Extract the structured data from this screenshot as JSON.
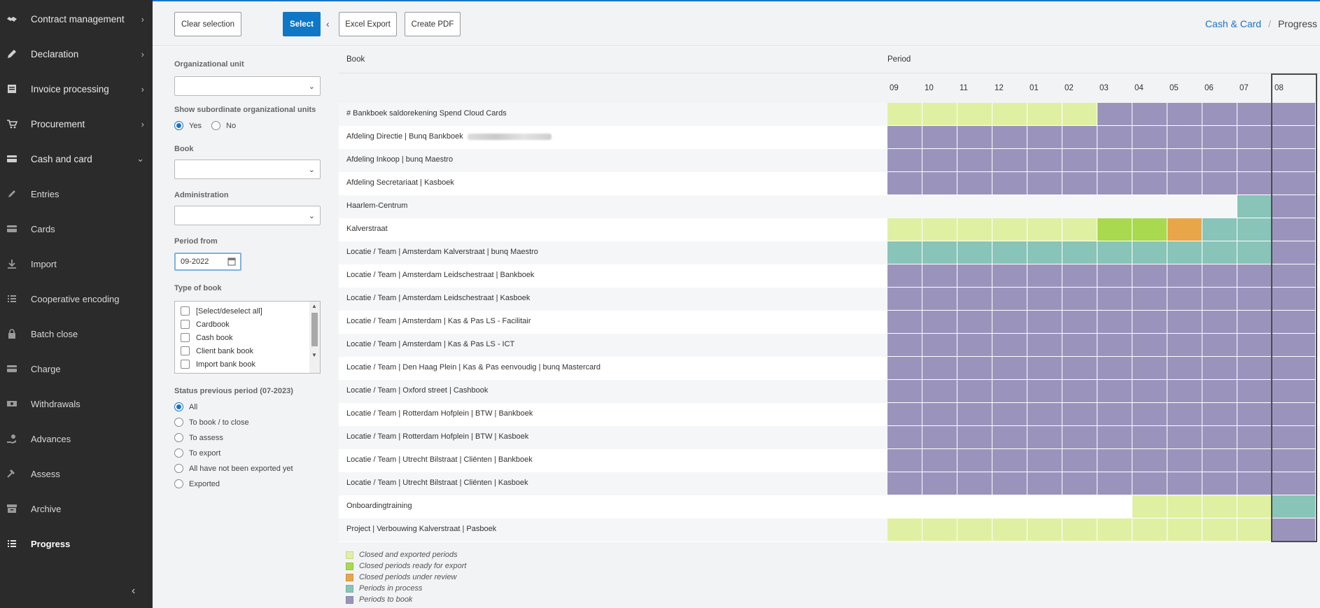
{
  "sidebar": {
    "items": [
      {
        "label": "Contract management",
        "icon": "handshake-icon",
        "chevron": "›"
      },
      {
        "label": "Declaration",
        "icon": "pencil-icon",
        "chevron": "›"
      },
      {
        "label": "Invoice processing",
        "icon": "document-icon",
        "chevron": "›"
      },
      {
        "label": "Procurement",
        "icon": "cart-icon",
        "chevron": "›"
      },
      {
        "label": "Cash and card",
        "icon": "card-icon",
        "chevron": "⌄"
      },
      {
        "label": "Entries",
        "icon": "pen-icon"
      },
      {
        "label": "Cards",
        "icon": "card-icon"
      },
      {
        "label": "Import",
        "icon": "download-icon"
      },
      {
        "label": "Cooperative encoding",
        "icon": "list-icon"
      },
      {
        "label": "Batch close",
        "icon": "lock-icon"
      },
      {
        "label": "Charge",
        "icon": "card-icon"
      },
      {
        "label": "Withdrawals",
        "icon": "cash-icon"
      },
      {
        "label": "Advances",
        "icon": "hand-coins-icon"
      },
      {
        "label": "Assess",
        "icon": "gavel-icon"
      },
      {
        "label": "Archive",
        "icon": "archive-icon"
      },
      {
        "label": "Progress",
        "icon": "list-icon"
      }
    ],
    "collapse": "‹"
  },
  "toolbar": {
    "clear_label": "Clear selection",
    "select_label": "Select",
    "chevron": "‹",
    "excel_label": "Excel Export",
    "pdf_label": "Create PDF"
  },
  "breadcrumb": {
    "parent": "Cash & Card",
    "separator": "/",
    "current": "Progress"
  },
  "filters": {
    "org_unit_label": "Organizational unit",
    "subordinate_label": "Show subordinate organizational units",
    "yes_label": "Yes",
    "no_label": "No",
    "subordinate_value": "Yes",
    "book_label": "Book",
    "administration_label": "Administration",
    "period_from_label": "Period from",
    "period_from_value": "09-2022",
    "type_label": "Type of book",
    "types": [
      "[Select/deselect all]",
      "Cardbook",
      "Cash book",
      "Client bank book",
      "Import bank book"
    ],
    "status_label": "Status previous period (07-2023)",
    "status_options": [
      "All",
      "To book / to close",
      "To assess",
      "To export",
      "All have not been exported yet",
      "Exported"
    ],
    "status_selected": "All"
  },
  "grid": {
    "book_header": "Book",
    "period_header": "Period",
    "months": [
      "09",
      "10",
      "11",
      "12",
      "01",
      "02",
      "03",
      "04",
      "05",
      "06",
      "07",
      "08"
    ],
    "current_month": "08",
    "status_colors": {
      "X": "#e0f0a2",
      "R": "#a9d94e",
      "U": "#e9a649",
      "P": "#88c4b8",
      "B": "#9a94bd",
      "N": ""
    },
    "rows": [
      {
        "book": "# Bankboek saldorekening Spend Cloud Cards",
        "statuses": [
          "X",
          "X",
          "X",
          "X",
          "X",
          "X",
          "B",
          "B",
          "B",
          "B",
          "B",
          "B"
        ]
      },
      {
        "book": "Afdeling Directie | Bunq Bankboek",
        "redacted": true,
        "statuses": [
          "B",
          "B",
          "B",
          "B",
          "B",
          "B",
          "B",
          "B",
          "B",
          "B",
          "B",
          "B"
        ]
      },
      {
        "book": "Afdeling Inkoop | bunq Maestro",
        "statuses": [
          "B",
          "B",
          "B",
          "B",
          "B",
          "B",
          "B",
          "B",
          "B",
          "B",
          "B",
          "B"
        ]
      },
      {
        "book": "Afdeling Secretariaat | Kasboek",
        "statuses": [
          "B",
          "B",
          "B",
          "B",
          "B",
          "B",
          "B",
          "B",
          "B",
          "B",
          "B",
          "B"
        ]
      },
      {
        "book": "Haarlem-Centrum",
        "statuses": [
          "N",
          "N",
          "N",
          "N",
          "N",
          "N",
          "N",
          "N",
          "N",
          "N",
          "P",
          "B"
        ]
      },
      {
        "book": "Kalverstraat",
        "statuses": [
          "X",
          "X",
          "X",
          "X",
          "X",
          "X",
          "R",
          "R",
          "U",
          "P",
          "P",
          "B"
        ]
      },
      {
        "book": "Locatie / Team | Amsterdam Kalverstraat | bunq Maestro",
        "statuses": [
          "P",
          "P",
          "P",
          "P",
          "P",
          "P",
          "P",
          "P",
          "P",
          "P",
          "P",
          "B"
        ]
      },
      {
        "book": "Locatie / Team | Amsterdam Leidschestraat | Bankboek",
        "statuses": [
          "B",
          "B",
          "B",
          "B",
          "B",
          "B",
          "B",
          "B",
          "B",
          "B",
          "B",
          "B"
        ]
      },
      {
        "book": "Locatie / Team | Amsterdam Leidschestraat | Kasboek",
        "statuses": [
          "B",
          "B",
          "B",
          "B",
          "B",
          "B",
          "B",
          "B",
          "B",
          "B",
          "B",
          "B"
        ]
      },
      {
        "book": "Locatie / Team | Amsterdam | Kas & Pas LS - Facilitair",
        "statuses": [
          "B",
          "B",
          "B",
          "B",
          "B",
          "B",
          "B",
          "B",
          "B",
          "B",
          "B",
          "B"
        ]
      },
      {
        "book": "Locatie / Team | Amsterdam | Kas & Pas LS - ICT",
        "statuses": [
          "B",
          "B",
          "B",
          "B",
          "B",
          "B",
          "B",
          "B",
          "B",
          "B",
          "B",
          "B"
        ]
      },
      {
        "book": "Locatie / Team | Den Haag Plein | Kas & Pas eenvoudig | bunq Mastercard",
        "statuses": [
          "B",
          "B",
          "B",
          "B",
          "B",
          "B",
          "B",
          "B",
          "B",
          "B",
          "B",
          "B"
        ]
      },
      {
        "book": "Locatie / Team | Oxford street | Cashbook",
        "statuses": [
          "B",
          "B",
          "B",
          "B",
          "B",
          "B",
          "B",
          "B",
          "B",
          "B",
          "B",
          "B"
        ]
      },
      {
        "book": "Locatie / Team | Rotterdam Hofplein | BTW | Bankboek",
        "statuses": [
          "B",
          "B",
          "B",
          "B",
          "B",
          "B",
          "B",
          "B",
          "B",
          "B",
          "B",
          "B"
        ]
      },
      {
        "book": "Locatie / Team | Rotterdam Hofplein | BTW | Kasboek",
        "statuses": [
          "B",
          "B",
          "B",
          "B",
          "B",
          "B",
          "B",
          "B",
          "B",
          "B",
          "B",
          "B"
        ]
      },
      {
        "book": "Locatie / Team | Utrecht Bilstraat | Cliënten | Bankboek",
        "statuses": [
          "B",
          "B",
          "B",
          "B",
          "B",
          "B",
          "B",
          "B",
          "B",
          "B",
          "B",
          "B"
        ]
      },
      {
        "book": "Locatie / Team | Utrecht Bilstraat | Cliënten | Kasboek",
        "statuses": [
          "B",
          "B",
          "B",
          "B",
          "B",
          "B",
          "B",
          "B",
          "B",
          "B",
          "B",
          "B"
        ]
      },
      {
        "book": "Onboardingtraining",
        "statuses": [
          "N",
          "N",
          "N",
          "N",
          "N",
          "N",
          "N",
          "X",
          "X",
          "X",
          "X",
          "P"
        ]
      },
      {
        "book": "Project | Verbouwing Kalverstraat | Pasboek",
        "statuses": [
          "X",
          "X",
          "X",
          "X",
          "X",
          "X",
          "X",
          "X",
          "X",
          "X",
          "X",
          "B"
        ]
      }
    ]
  },
  "legend": [
    {
      "label": "Closed and exported periods",
      "color": "#e0f0a2"
    },
    {
      "label": "Closed periods ready for export",
      "color": "#a9d94e"
    },
    {
      "label": "Closed periods under review",
      "color": "#e9a649"
    },
    {
      "label": "Periods in process",
      "color": "#88c4b8"
    },
    {
      "label": "Periods to book",
      "color": "#9a94bd"
    }
  ]
}
